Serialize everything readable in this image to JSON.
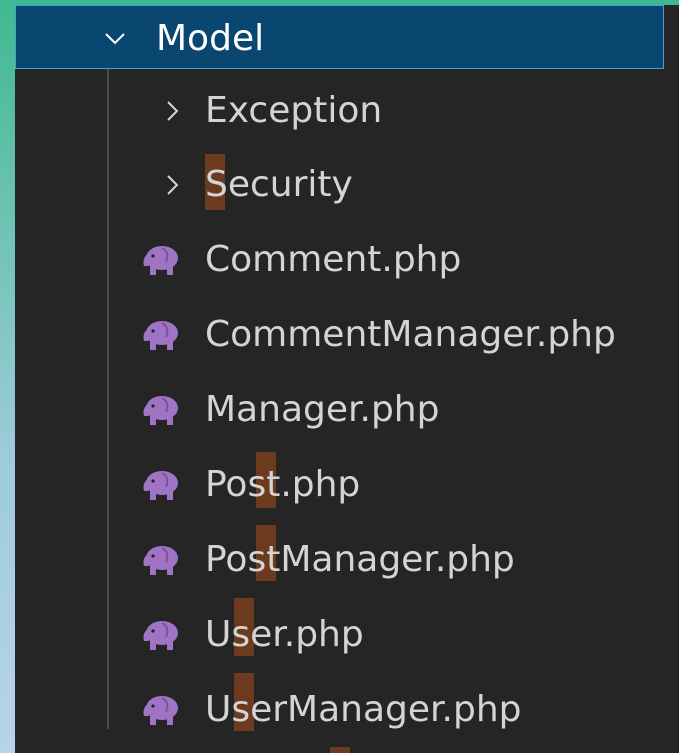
{
  "explorer": {
    "folder": {
      "label": "Model",
      "expanded": true,
      "icon": "chevron-down-icon"
    },
    "subfolders": [
      {
        "label": "Exception",
        "icon": "chevron-right-icon"
      },
      {
        "label": "Security",
        "icon": "chevron-right-icon"
      }
    ],
    "files": [
      {
        "label": "Comment.php",
        "icon": "php-elephant-icon"
      },
      {
        "label": "CommentManager.php",
        "icon": "php-elephant-icon"
      },
      {
        "label": "Manager.php",
        "icon": "php-elephant-icon"
      },
      {
        "label": "Post.php",
        "icon": "php-elephant-icon"
      },
      {
        "label": "PostManager.php",
        "icon": "php-elephant-icon"
      },
      {
        "label": "User.php",
        "icon": "php-elephant-icon"
      },
      {
        "label": "UserManager.php",
        "icon": "php-elephant-icon"
      }
    ]
  },
  "colors": {
    "selected_background": "#094771",
    "panel_background": "#252526",
    "php_icon": "#a074c4",
    "search_marker": "#6b3a1f"
  }
}
